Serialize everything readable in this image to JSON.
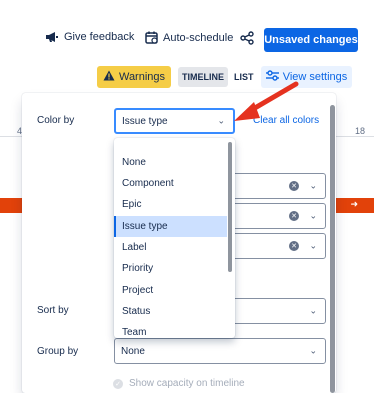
{
  "topbar": {
    "feedback_label": "Give feedback",
    "autoschedule_label": "Auto-schedule",
    "unsaved_label": "Unsaved changes"
  },
  "toolbar": {
    "warnings_label": "Warnings",
    "timeline_label": "TIMELINE",
    "list_label": "LIST",
    "view_settings_label": "View settings"
  },
  "background": {
    "left_num": "4",
    "right_num": "18"
  },
  "panel": {
    "color_by_label": "Color by",
    "color_by_value": "Issue type",
    "clear_colors_label": "Clear all colors",
    "sort_by_label": "Sort by",
    "group_by_label": "Group by",
    "group_by_value": "None",
    "capacity_label": "Show capacity on timeline"
  },
  "dropdown": {
    "options": [
      "None",
      "Component",
      "Epic",
      "Issue type",
      "Label",
      "Priority",
      "Project",
      "Status",
      "Team"
    ],
    "selected": "Issue type"
  },
  "colors": {
    "primary": "#0c66e4",
    "warning": "#f5cd47",
    "arrow": "#e5321f",
    "selected_bg": "#cce0ff"
  },
  "icons": [
    "megaphone-icon",
    "calendar-icon",
    "share-icon",
    "warning-icon",
    "settings-sliders-icon",
    "chevron-down-icon",
    "clear-icon",
    "check-icon"
  ]
}
